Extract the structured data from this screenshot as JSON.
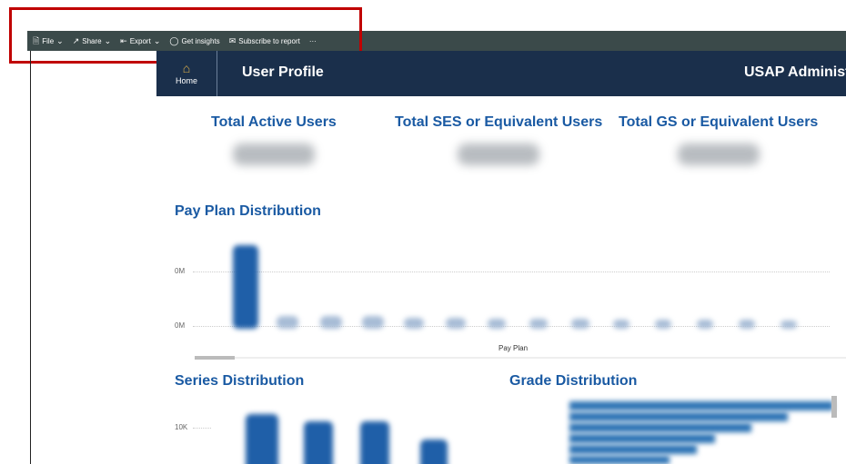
{
  "toolbar": {
    "file": "File",
    "share": "Share",
    "export": "Export",
    "insights": "Get insights",
    "subscribe": "Subscribe to report",
    "more": "···"
  },
  "header": {
    "home_label": "Home",
    "page_title": "User Profile",
    "org_title": "USAP Administ"
  },
  "kpis": {
    "active_users": "Total Active Users",
    "ses_users": "Total SES or Equivalent Users",
    "gs_users": "Total GS or Equivalent Users"
  },
  "pay_plan": {
    "title": "Pay Plan Distribution",
    "y_tick_top": "0M",
    "y_tick_bottom": "0M",
    "x_title": "Pay Plan"
  },
  "series": {
    "title": "Series Distribution",
    "y_tick": "10K"
  },
  "grade": {
    "title": "Grade Distribution"
  },
  "colors": {
    "header_bg": "#1a2f4b",
    "accent": "#1a5aa3",
    "bar": "#1f5fa8",
    "highlight": "#c00000"
  }
}
